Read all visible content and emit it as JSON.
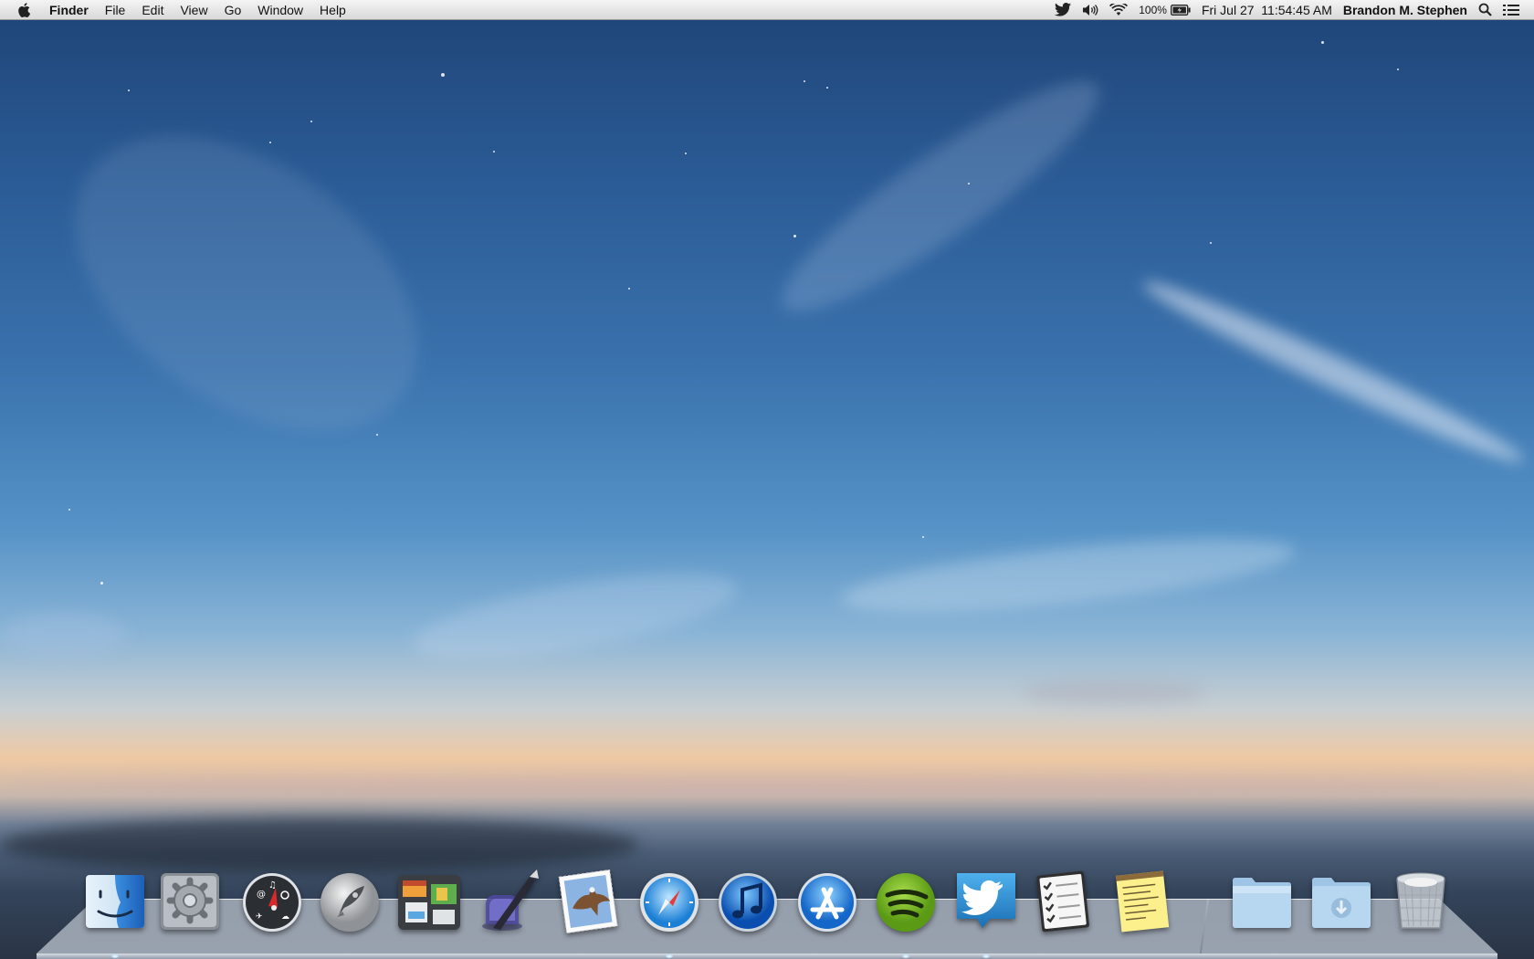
{
  "menubar": {
    "apple_icon": "apple-logo-icon",
    "app_name": "Finder",
    "menus": [
      "File",
      "Edit",
      "View",
      "Go",
      "Window",
      "Help"
    ],
    "status": {
      "twitter_icon": "twitter-bird-icon",
      "volume_icon": "speaker-volume-icon",
      "wifi_icon": "wifi-icon",
      "battery_percent": "100%",
      "battery_icon": "battery-charging-icon",
      "datetime": "Fri Jul 27  11:54:45 AM",
      "user": "Brandon M. Stephen",
      "spotlight_icon": "spotlight-search-icon",
      "notification_icon": "notification-center-icon"
    }
  },
  "desktop": {
    "wallpaper": "Ocean horizon at dusk with starry blue sky"
  },
  "dock": {
    "apps": [
      {
        "name": "Finder",
        "icon": "finder-icon",
        "running": true
      },
      {
        "name": "System Preferences",
        "icon": "system-preferences-icon",
        "running": false
      },
      {
        "name": "Dashboard",
        "icon": "dashboard-icon",
        "running": false
      },
      {
        "name": "Launchpad",
        "icon": "launchpad-icon",
        "running": false
      },
      {
        "name": "Mission Control",
        "icon": "mission-control-icon",
        "running": false
      },
      {
        "name": "iA Writer",
        "icon": "ink-pen-icon",
        "running": false
      },
      {
        "name": "Mail",
        "icon": "mail-stamp-icon",
        "running": false
      },
      {
        "name": "Safari",
        "icon": "safari-compass-icon",
        "running": true
      },
      {
        "name": "iTunes",
        "icon": "itunes-icon",
        "running": false
      },
      {
        "name": "App Store",
        "icon": "app-store-icon",
        "running": false
      },
      {
        "name": "Spotify",
        "icon": "spotify-icon",
        "running": true
      },
      {
        "name": "Twitter",
        "icon": "twitter-icon",
        "running": true
      },
      {
        "name": "Reminders",
        "icon": "reminders-checklist-icon",
        "running": false
      },
      {
        "name": "Notes",
        "icon": "notes-paper-icon",
        "running": false
      }
    ],
    "stacks": [
      {
        "name": "Applications",
        "icon": "folder-icon"
      },
      {
        "name": "Downloads",
        "icon": "downloads-folder-icon"
      },
      {
        "name": "Trash",
        "icon": "trash-can-icon"
      }
    ]
  },
  "colors": {
    "menubar_bg": "#e6e6e6",
    "sky_top": "#1f4477",
    "sky_horizon": "#efc9a4",
    "sea": "#4a5d76"
  }
}
